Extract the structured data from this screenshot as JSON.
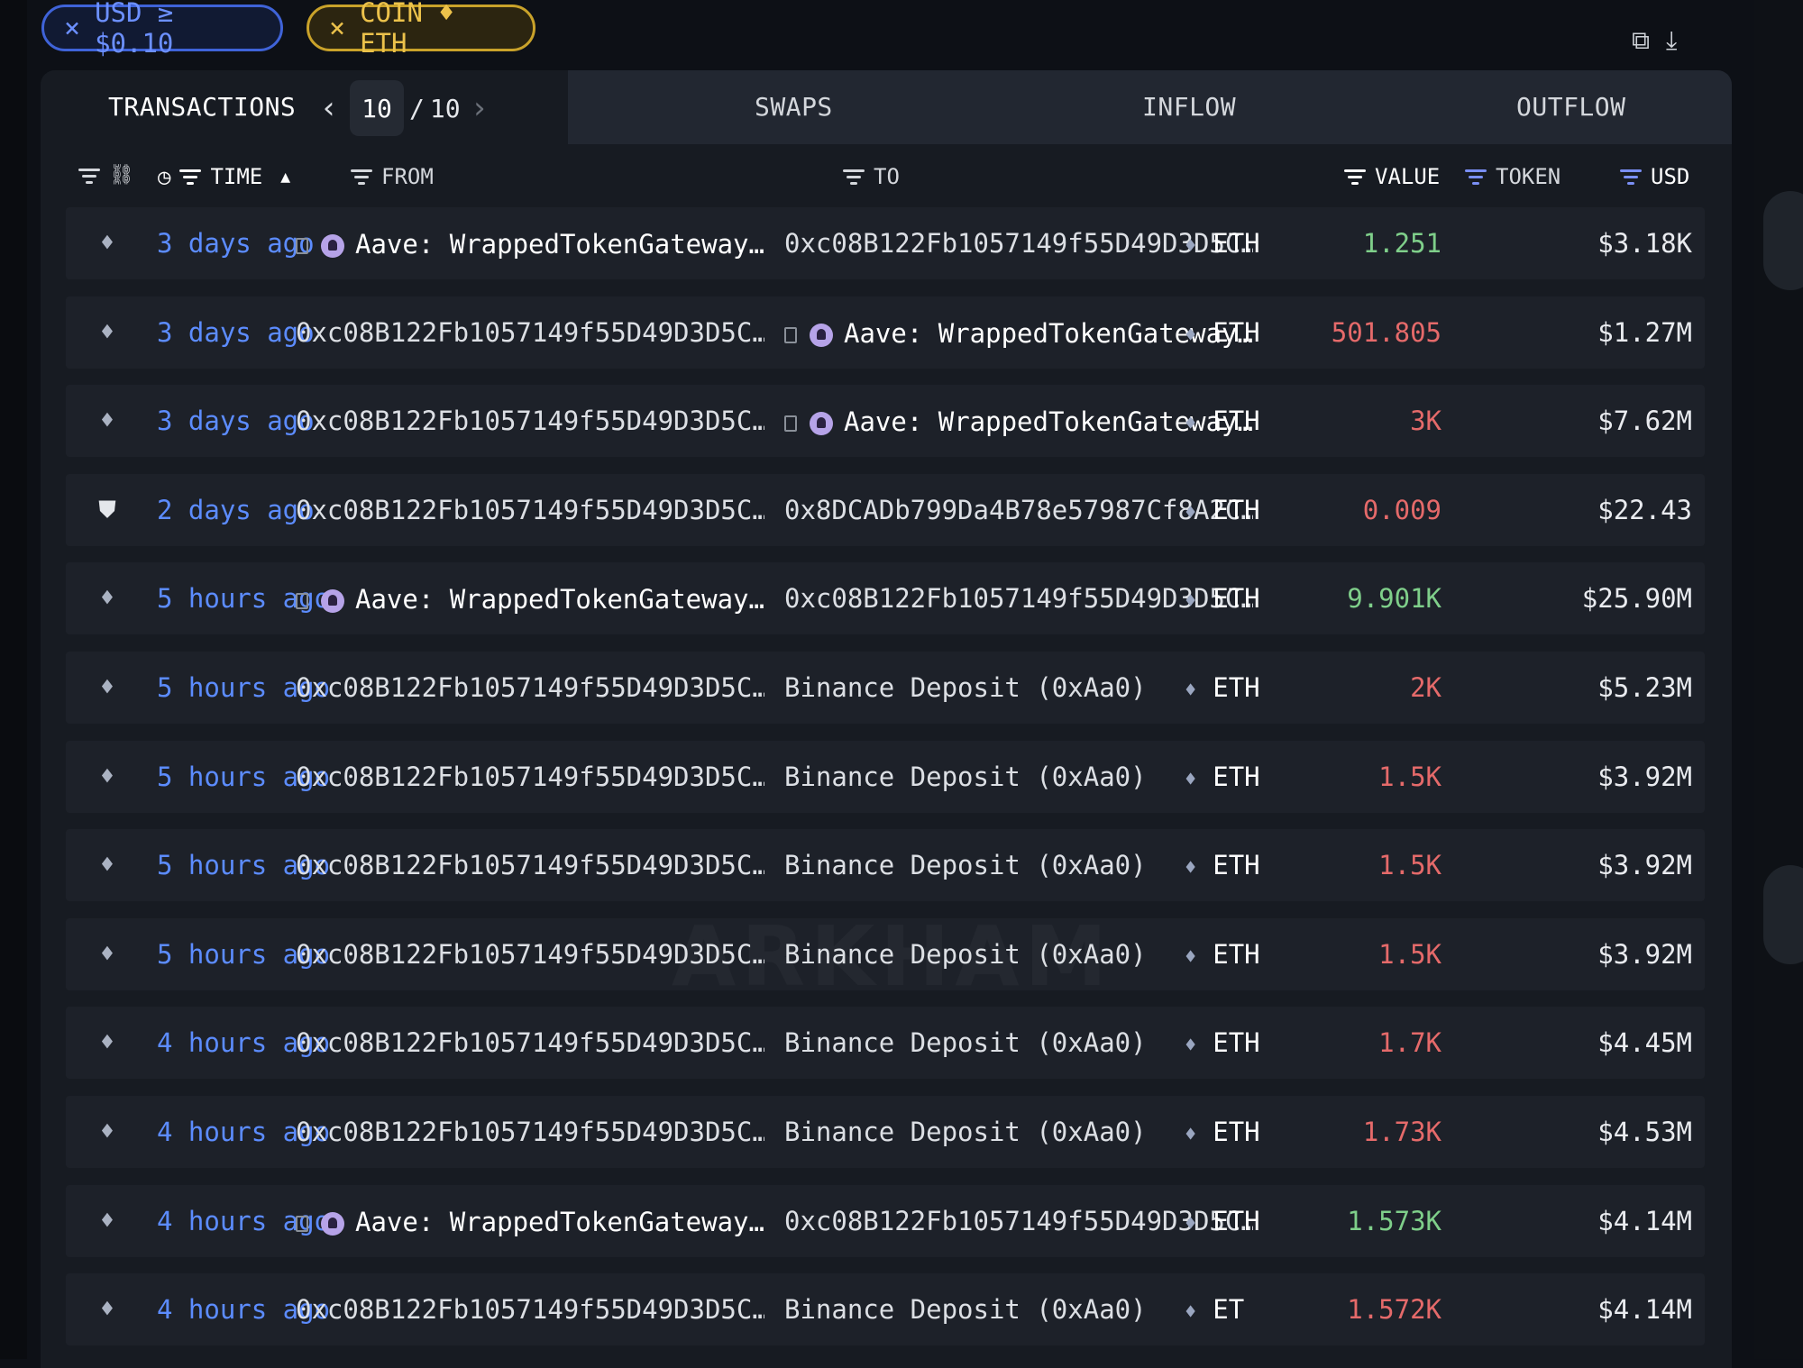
{
  "filters": {
    "usd_chip": {
      "close": "×",
      "label": "USD ≥ $0.10"
    },
    "coin_chip": {
      "close": "×",
      "label": "COIN ♦ ETH"
    }
  },
  "tabs": {
    "transactions": "TRANSACTIONS",
    "page_current": "10",
    "page_sep": "/",
    "page_total": "10",
    "swaps": "SWAPS",
    "inflow": "INFLOW",
    "outflow": "OUTFLOW"
  },
  "columns": {
    "time": "TIME",
    "from": "FROM",
    "to": "TO",
    "value": "VALUE",
    "token": "TOKEN",
    "usd": "USD"
  },
  "rows": [
    {
      "icon": "eth-icon",
      "time": "3 days ago",
      "from": {
        "entity": true,
        "text": "Aave: WrappedTokenGateway…"
      },
      "to": {
        "entity": false,
        "text": "0xc08B122Fb1057149f55D49D3D5C…"
      },
      "value": "1.251",
      "dir": "in",
      "token": "ETH",
      "usd": "$3.18K"
    },
    {
      "icon": "eth-icon",
      "time": "3 days ago",
      "from": {
        "entity": false,
        "text": "0xc08B122Fb1057149f55D49D3D5C…"
      },
      "to": {
        "entity": true,
        "text": "Aave: WrappedTokenGateway…"
      },
      "value": "501.805",
      "dir": "out",
      "token": "ETH",
      "usd": "$1.27M"
    },
    {
      "icon": "eth-icon",
      "time": "3 days ago",
      "from": {
        "entity": false,
        "text": "0xc08B122Fb1057149f55D49D3D5C…"
      },
      "to": {
        "entity": true,
        "text": "Aave: WrappedTokenGateway…"
      },
      "value": "3K",
      "dir": "out",
      "token": "ETH",
      "usd": "$7.62M"
    },
    {
      "icon": "shield-icon",
      "time": "2 days ago",
      "from": {
        "entity": false,
        "text": "0xc08B122Fb1057149f55D49D3D5C…"
      },
      "to": {
        "entity": false,
        "text": "0x8DCADb799Da4B78e57987Cf8A2C…"
      },
      "value": "0.009",
      "dir": "out",
      "token": "ETH",
      "usd": "$22.43"
    },
    {
      "icon": "eth-icon",
      "time": "5 hours ago",
      "from": {
        "entity": true,
        "text": "Aave: WrappedTokenGateway…"
      },
      "to": {
        "entity": false,
        "text": "0xc08B122Fb1057149f55D49D3D5C…"
      },
      "value": "9.901K",
      "dir": "in",
      "token": "ETH",
      "usd": "$25.90M"
    },
    {
      "icon": "eth-icon",
      "time": "5 hours ago",
      "from": {
        "entity": false,
        "text": "0xc08B122Fb1057149f55D49D3D5C…"
      },
      "to": {
        "entity": false,
        "text": "Binance Deposit (0xAa0)"
      },
      "value": "2K",
      "dir": "out",
      "token": "ETH",
      "usd": "$5.23M"
    },
    {
      "icon": "eth-icon",
      "time": "5 hours ago",
      "from": {
        "entity": false,
        "text": "0xc08B122Fb1057149f55D49D3D5C…"
      },
      "to": {
        "entity": false,
        "text": "Binance Deposit (0xAa0)"
      },
      "value": "1.5K",
      "dir": "out",
      "token": "ETH",
      "usd": "$3.92M"
    },
    {
      "icon": "eth-icon",
      "time": "5 hours ago",
      "from": {
        "entity": false,
        "text": "0xc08B122Fb1057149f55D49D3D5C…"
      },
      "to": {
        "entity": false,
        "text": "Binance Deposit (0xAa0)"
      },
      "value": "1.5K",
      "dir": "out",
      "token": "ETH",
      "usd": "$3.92M"
    },
    {
      "icon": "eth-icon",
      "time": "5 hours ago",
      "from": {
        "entity": false,
        "text": "0xc08B122Fb1057149f55D49D3D5C…"
      },
      "to": {
        "entity": false,
        "text": "Binance Deposit (0xAa0)"
      },
      "value": "1.5K",
      "dir": "out",
      "token": "ETH",
      "usd": "$3.92M"
    },
    {
      "icon": "eth-icon",
      "time": "4 hours ago",
      "from": {
        "entity": false,
        "text": "0xc08B122Fb1057149f55D49D3D5C…"
      },
      "to": {
        "entity": false,
        "text": "Binance Deposit (0xAa0)"
      },
      "value": "1.7K",
      "dir": "out",
      "token": "ETH",
      "usd": "$4.45M"
    },
    {
      "icon": "eth-icon",
      "time": "4 hours ago",
      "from": {
        "entity": false,
        "text": "0xc08B122Fb1057149f55D49D3D5C…"
      },
      "to": {
        "entity": false,
        "text": "Binance Deposit (0xAa0)"
      },
      "value": "1.73K",
      "dir": "out",
      "token": "ETH",
      "usd": "$4.53M"
    },
    {
      "icon": "eth-icon",
      "time": "4 hours ago",
      "from": {
        "entity": true,
        "text": "Aave: WrappedTokenGateway…"
      },
      "to": {
        "entity": false,
        "text": "0xc08B122Fb1057149f55D49D3D5C…"
      },
      "value": "1.573K",
      "dir": "in",
      "token": "ETH",
      "usd": "$4.14M"
    },
    {
      "icon": "eth-icon",
      "time": "4 hours ago",
      "from": {
        "entity": false,
        "text": "0xc08B122Fb1057149f55D49D3D5C…"
      },
      "to": {
        "entity": false,
        "text": "Binance Deposit (0xAa0)"
      },
      "value": "1.572K",
      "dir": "out",
      "token": "ET",
      "usd": "$4.14M"
    }
  ],
  "watermark": "ARKHAM",
  "colors": {
    "in": "#7fcf8a",
    "out": "#e56a6a",
    "time": "#5c8cff",
    "usd_chip": "#3f63d8",
    "coin_chip": "#c9a22a"
  }
}
